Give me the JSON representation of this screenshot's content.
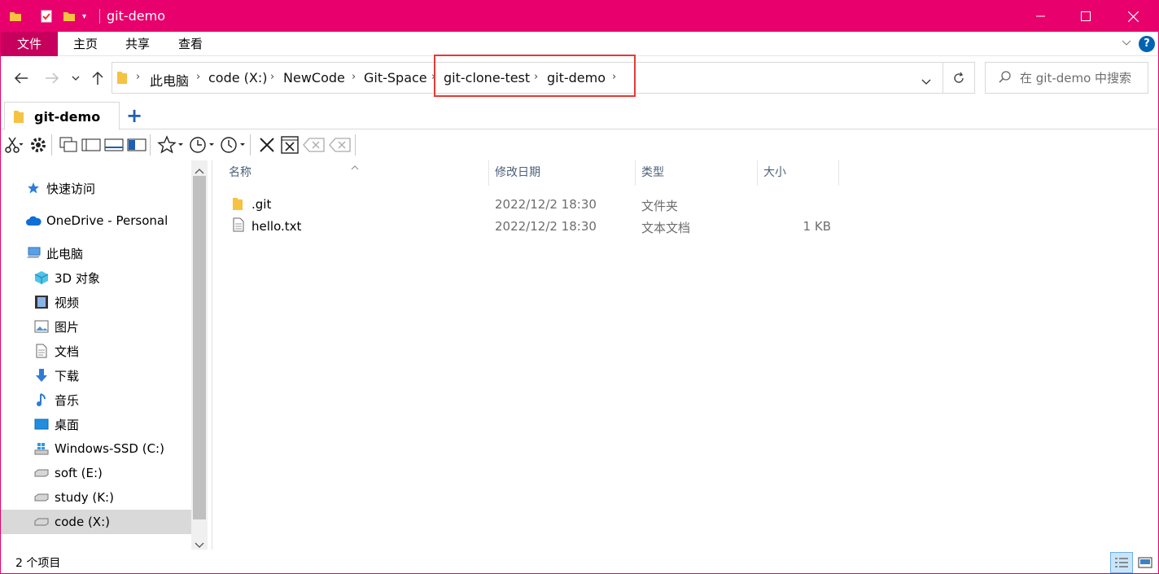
{
  "window": {
    "title": "git-demo"
  },
  "ribbon": {
    "tabs": [
      "文件",
      "主页",
      "共享",
      "查看"
    ],
    "help": "?"
  },
  "address": {
    "crumbs": [
      "此电脑",
      "code (X:)",
      "NewCode",
      "Git-Space",
      "git-clone-test",
      "git-demo"
    ],
    "search_placeholder": "在 git-demo 中搜索"
  },
  "tabs": {
    "active": "git-demo",
    "add": "+"
  },
  "nav": {
    "quick_access": "快速访问",
    "onedrive": "OneDrive - Personal",
    "this_pc": "此电脑",
    "items": [
      "3D 对象",
      "视频",
      "图片",
      "文档",
      "下载",
      "音乐",
      "桌面",
      "Windows-SSD (C:)",
      "soft (E:)",
      "study (K:)",
      "code (X:)"
    ],
    "selected": "code (X:)"
  },
  "list": {
    "columns": {
      "name": "名称",
      "date": "修改日期",
      "type": "类型",
      "size": "大小"
    },
    "rows": [
      {
        "name": ".git",
        "date": "2022/12/2 18:30",
        "type": "文件夹",
        "size": "",
        "icon": "folder-icon"
      },
      {
        "name": "hello.txt",
        "date": "2022/12/2 18:30",
        "type": "文本文档",
        "size": "1 KB",
        "icon": "text-file-icon"
      }
    ]
  },
  "status": {
    "count": "2 个项目"
  },
  "colors": {
    "accent": "#e8006c",
    "file_tab": "#c7005d",
    "folder": "#f5c242",
    "highlight_box": "#e53935"
  }
}
